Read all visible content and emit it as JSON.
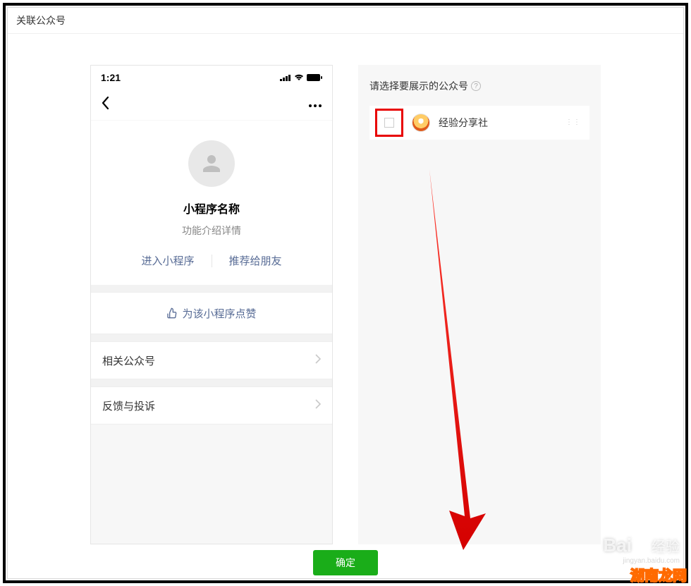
{
  "dialog": {
    "title": "关联公众号",
    "confirm_label": "确定"
  },
  "phone": {
    "status": {
      "time": "1:21"
    },
    "profile": {
      "name": "小程序名称",
      "desc": "功能介绍详情"
    },
    "actions": {
      "enter": "进入小程序",
      "recommend": "推荐给朋友"
    },
    "praise": "为该小程序点赞",
    "rows": {
      "related": "相关公众号",
      "feedback": "反馈与投诉"
    }
  },
  "panel": {
    "title": "请选择要展示的公众号",
    "accounts": [
      {
        "name": "经验分享社"
      }
    ]
  },
  "watermark": {
    "brand_a": "Bai",
    "brand_b": "经验",
    "url": "jingyan.baidu.com",
    "hunan": "湖南龙网"
  }
}
